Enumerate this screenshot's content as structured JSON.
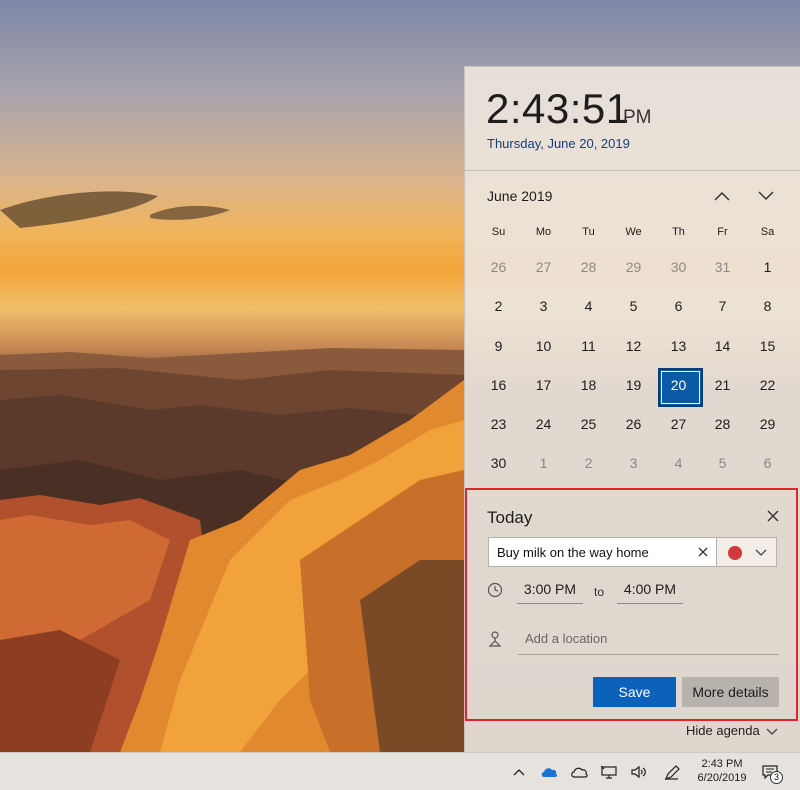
{
  "clock": {
    "time": "2:43:51",
    "ampm": "PM",
    "date": "Thursday, June 20, 2019"
  },
  "calendar": {
    "month_label": "June 2019",
    "weekdays": [
      "Su",
      "Mo",
      "Tu",
      "We",
      "Th",
      "Fr",
      "Sa"
    ],
    "weeks": [
      [
        "26",
        "27",
        "28",
        "29",
        "30",
        "31",
        "1"
      ],
      [
        "2",
        "3",
        "4",
        "5",
        "6",
        "7",
        "8"
      ],
      [
        "9",
        "10",
        "11",
        "12",
        "13",
        "14",
        "15"
      ],
      [
        "16",
        "17",
        "18",
        "19",
        "20",
        "21",
        "22"
      ],
      [
        "23",
        "24",
        "25",
        "26",
        "27",
        "28",
        "29"
      ],
      [
        "30",
        "1",
        "2",
        "3",
        "4",
        "5",
        "6"
      ]
    ],
    "selected": "20"
  },
  "agenda": {
    "title": "Today",
    "event_name": "Buy milk on the way home",
    "event_color": "#d03a3c",
    "start_time": "3:00 PM",
    "to_label": "to",
    "end_time": "4:00 PM",
    "location_placeholder": "Add a location",
    "save_label": "Save",
    "more_details_label": "More details",
    "hide_agenda_label": "Hide agenda"
  },
  "taskbar": {
    "time": "2:43 PM",
    "date": "6/20/2019",
    "notification_count": "3",
    "tray_icons": [
      "chevron-up-icon",
      "onedrive-icon",
      "cloud-icon",
      "network-icon",
      "volume-icon",
      "pen-icon"
    ]
  },
  "colors": {
    "accent": "#0b62b8",
    "highlight_border": "#e0262c"
  }
}
